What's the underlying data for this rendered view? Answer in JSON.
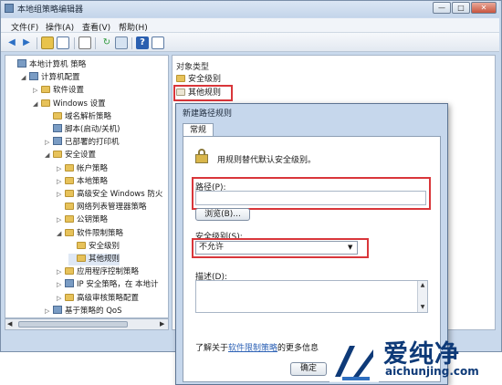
{
  "window": {
    "title": "本地组策略编辑器",
    "controls": {
      "minimize": "—",
      "maximize": "□",
      "close": "✕"
    }
  },
  "menu": [
    "文件(F)",
    "操作(A)",
    "查看(V)",
    "帮助(H)"
  ],
  "toolbar": {
    "icons": [
      "back-icon",
      "forward-icon",
      "up-folder-icon",
      "show-hide-tree-icon",
      "properties-icon",
      "refresh-icon",
      "export-list-icon",
      "help-icon",
      "view-icon"
    ]
  },
  "tree": [
    {
      "label": "本地计算机 策略",
      "indent": 0,
      "arrow": "",
      "icon": "policy"
    },
    {
      "label": "计算机配置",
      "indent": 1,
      "arrow": "◢",
      "icon": "computer"
    },
    {
      "label": "软件设置",
      "indent": 2,
      "arrow": "▷",
      "icon": "folder"
    },
    {
      "label": "Windows 设置",
      "indent": 2,
      "arrow": "◢",
      "icon": "folder"
    },
    {
      "label": "域名解析策略",
      "indent": 3,
      "arrow": "",
      "icon": "folder"
    },
    {
      "label": "脚本(启动/关机)",
      "indent": 3,
      "arrow": "",
      "icon": "script"
    },
    {
      "label": "已部署的打印机",
      "indent": 3,
      "arrow": "▷",
      "icon": "printer"
    },
    {
      "label": "安全设置",
      "indent": 3,
      "arrow": "◢",
      "icon": "folder"
    },
    {
      "label": "帐户策略",
      "indent": 4,
      "arrow": "▷",
      "icon": "folder"
    },
    {
      "label": "本地策略",
      "indent": 4,
      "arrow": "▷",
      "icon": "folder"
    },
    {
      "label": "高级安全 Windows 防火",
      "indent": 4,
      "arrow": "▷",
      "icon": "folder"
    },
    {
      "label": "网络列表管理器策略",
      "indent": 4,
      "arrow": "",
      "icon": "folder"
    },
    {
      "label": "公钥策略",
      "indent": 4,
      "arrow": "▷",
      "icon": "folder"
    },
    {
      "label": "软件限制策略",
      "indent": 4,
      "arrow": "◢",
      "icon": "folder"
    },
    {
      "label": "安全级别",
      "indent": 5,
      "arrow": "",
      "icon": "folder"
    },
    {
      "label": "其他规则",
      "indent": 5,
      "arrow": "",
      "icon": "folder"
    },
    {
      "label": "应用程序控制策略",
      "indent": 4,
      "arrow": "▷",
      "icon": "folder"
    },
    {
      "label": "IP 安全策略，在 本地计",
      "indent": 4,
      "arrow": "▷",
      "icon": "ipsec"
    },
    {
      "label": "高级审核策略配置",
      "indent": 4,
      "arrow": "▷",
      "icon": "folder"
    },
    {
      "label": "基于策略的 QoS",
      "indent": 3,
      "arrow": "▷",
      "icon": "chart"
    }
  ],
  "right_pane": {
    "column_header": "对象类型",
    "rows": [
      "安全级别",
      "其他规则"
    ]
  },
  "dialog": {
    "title": "新建路径规则",
    "tab": "常规",
    "description": "用规则替代默认安全级别。",
    "path_label": "路径(P):",
    "path_value": "",
    "browse_button": "浏览(B)...",
    "security_level_label": "安全级别(S):",
    "security_level_value": "不允许",
    "desc_label": "描述(D):",
    "desc_value": "",
    "learn_prefix": "了解关于",
    "learn_link": "软件限制策略",
    "learn_suffix": "的更多信息",
    "ok_button": "确定"
  },
  "watermark": {
    "text": "爱纯净",
    "url": "aichunjing.com"
  },
  "colors": {
    "highlight": "#d9363a",
    "link": "#2f63b6",
    "watermark": "#0e3a78"
  }
}
